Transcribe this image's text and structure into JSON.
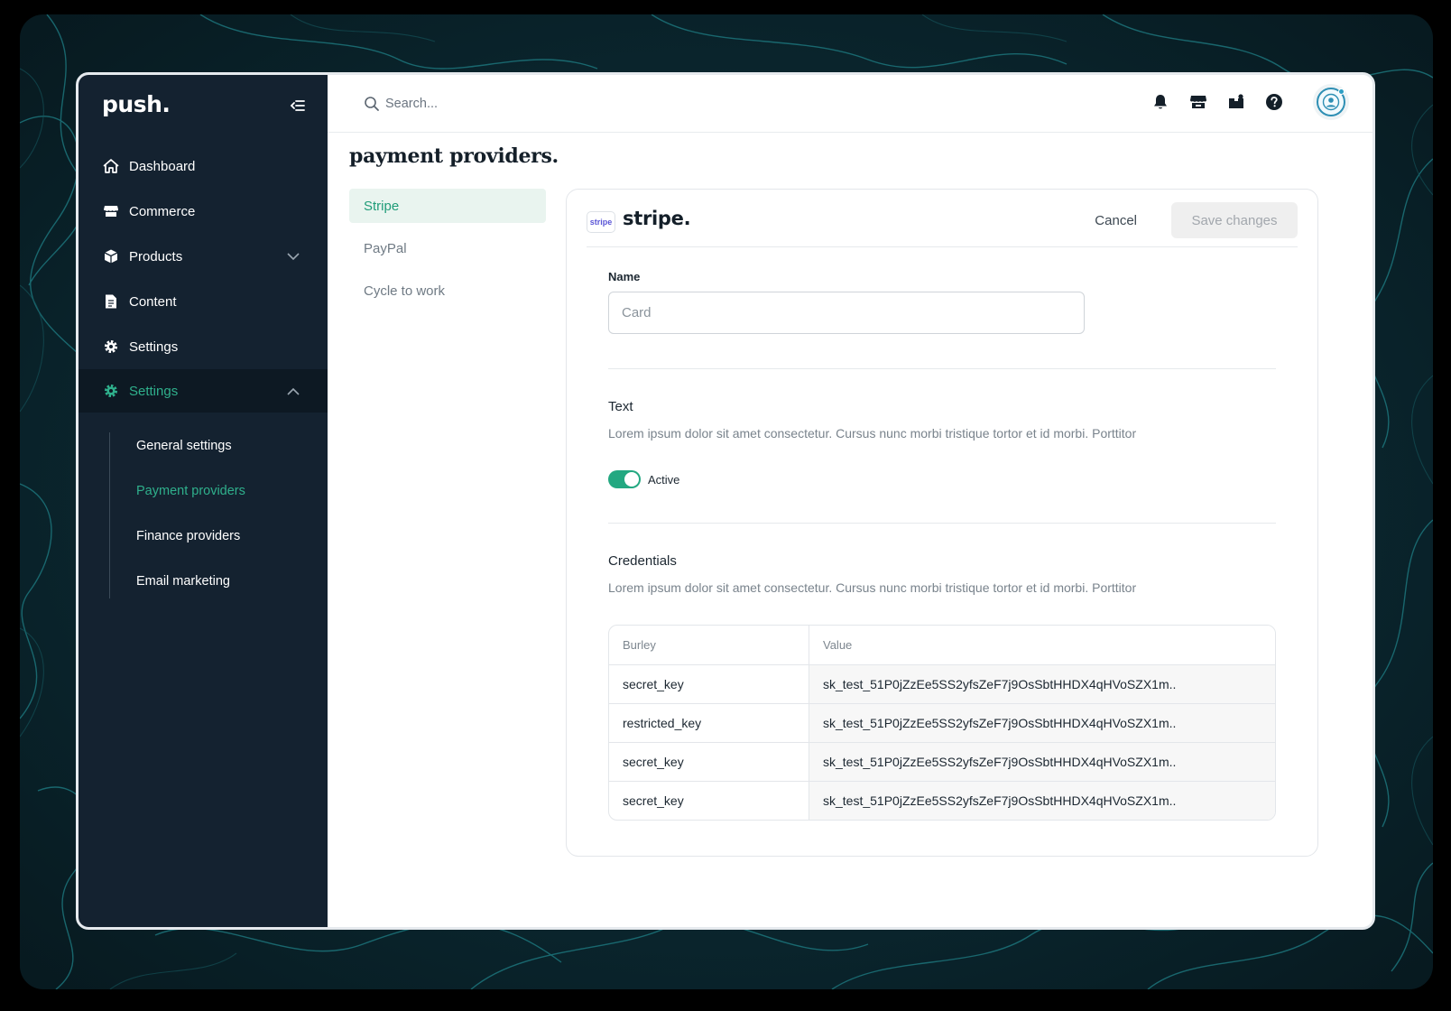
{
  "app": {
    "logo": "push."
  },
  "sidebar": {
    "items": [
      {
        "label": "Dashboard",
        "icon": "home-icon"
      },
      {
        "label": "Commerce",
        "icon": "store-icon"
      },
      {
        "label": "Products",
        "icon": "box-icon",
        "expandable": true
      },
      {
        "label": "Content",
        "icon": "document-icon"
      },
      {
        "label": "Settings",
        "icon": "gear-icon"
      }
    ],
    "active_item": {
      "label": "Settings",
      "icon": "gear-icon",
      "expanded": true
    },
    "sub_items": [
      {
        "label": "General settings",
        "active": false
      },
      {
        "label": "Payment providers",
        "active": true
      },
      {
        "label": "Finance providers",
        "active": false
      },
      {
        "label": "Email marketing",
        "active": false
      }
    ]
  },
  "topbar": {
    "search_placeholder": "Search...",
    "icons": [
      "bell-icon",
      "store-icon",
      "inbox-icon",
      "help-icon",
      "user-avatar"
    ]
  },
  "page": {
    "title": "payment providers."
  },
  "providers": [
    {
      "label": "Stripe",
      "active": true
    },
    {
      "label": "PayPal",
      "active": false
    },
    {
      "label": "Cycle to work",
      "active": false
    }
  ],
  "card": {
    "badge": "stripe",
    "brand": "stripe.",
    "cancel_label": "Cancel",
    "save_label": "Save changes",
    "name_label": "Name",
    "name_placeholder": "Card",
    "text_section": {
      "title": "Text",
      "description": "Lorem ipsum dolor sit amet consectetur. Cursus nunc morbi tristique tortor et id morbi. Porttitor"
    },
    "toggle": {
      "label": "Active",
      "on": true
    },
    "credentials_section": {
      "title": "Credentials",
      "description": "Lorem ipsum dolor sit amet consectetur. Cursus nunc morbi tristique tortor et id morbi. Porttitor"
    },
    "credentials_table": {
      "columns": [
        "Burley",
        "Value"
      ],
      "rows": [
        {
          "key": "secret_key",
          "value": "sk_test_51P0jZzEe5SS2yfsZeF7j9OsSbtHHDX4qHVoSZX1m.."
        },
        {
          "key": "restricted_key",
          "value": "sk_test_51P0jZzEe5SS2yfsZeF7j9OsSbtHHDX4qHVoSZX1m.."
        },
        {
          "key": "secret_key",
          "value": "sk_test_51P0jZzEe5SS2yfsZeF7j9OsSbtHHDX4qHVoSZX1m.."
        },
        {
          "key": "secret_key",
          "value": "sk_test_51P0jZzEe5SS2yfsZeF7j9OsSbtHHDX4qHVoSZX1m.."
        }
      ]
    }
  },
  "colors": {
    "sidebar_bg": "#142230",
    "accent": "#2fb08c",
    "toggle_on": "#23a881",
    "provider_active_bg": "#e9f4ef"
  }
}
